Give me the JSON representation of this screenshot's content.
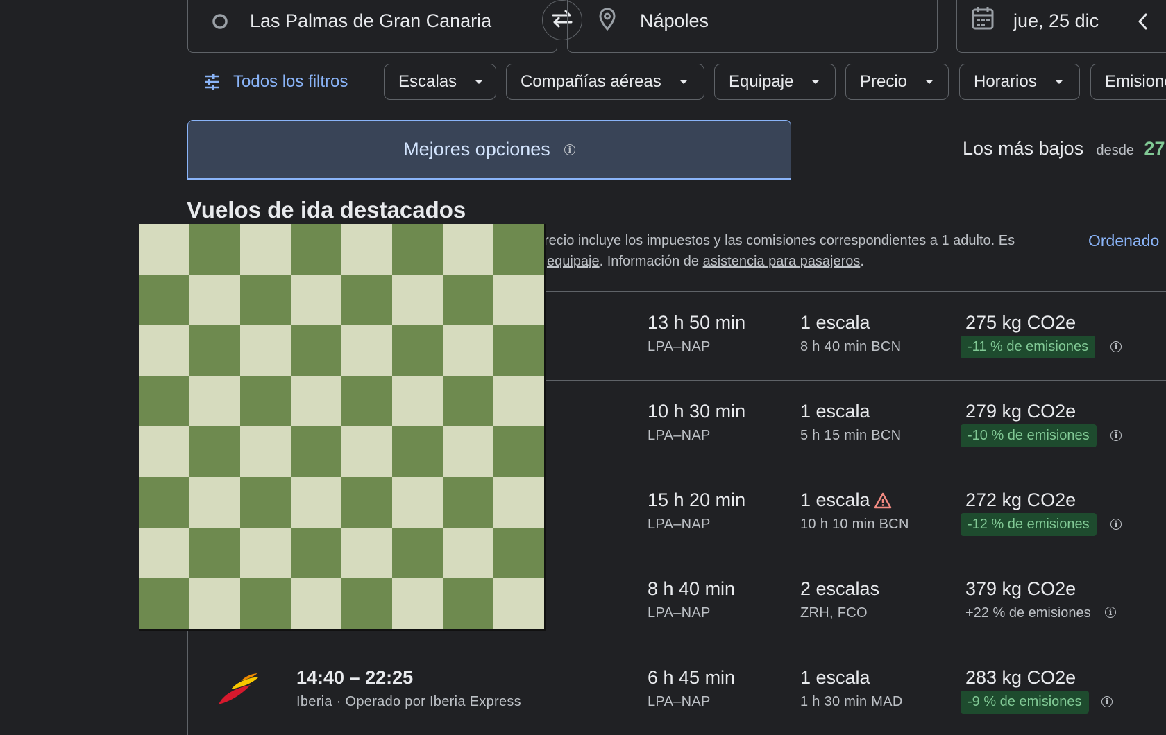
{
  "search": {
    "origin": "Las Palmas de Gran Canaria",
    "destination": "Nápoles",
    "date": "jue, 25 dic"
  },
  "filters": {
    "all_label": "Todos los filtros",
    "chips": [
      "Escalas",
      "Compañías aéreas",
      "Equipaje",
      "Precio",
      "Horarios",
      "Emisiones"
    ]
  },
  "tabs": {
    "best": "Mejores opciones",
    "lowest": "Los más bajos",
    "lowest_from": "desde",
    "lowest_price_visible": "27"
  },
  "section": {
    "title": "Vuelos de ida destacados",
    "notice_line1": "recio incluye los impuestos y las comisiones correspondientes a 1 adulto. Es",
    "notice_line2_link1": "equipaje",
    "notice_line2_mid": ". Información de ",
    "notice_line2_link2": "asistencia para pasajeros",
    "notice_line2_end": ".",
    "sort_label": "Ordenado"
  },
  "flights": [
    {
      "duration": "13 h 50 min",
      "route": "LPA–NAP",
      "stops": "1 escala",
      "stop_detail": "8 h 40 min BCN",
      "co2": "275 kg CO2e",
      "emissions": "-11 % de emisiones",
      "warning": false
    },
    {
      "duration": "10 h 30 min",
      "route": "LPA–NAP",
      "stops": "1 escala",
      "stop_detail": "5 h 15 min BCN",
      "co2": "279 kg CO2e",
      "emissions": "-10 % de emisiones",
      "warning": false
    },
    {
      "duration": "15 h 20 min",
      "route": "LPA–NAP",
      "stops": "1 escala",
      "stop_detail": "10 h 10 min BCN",
      "co2": "272 kg CO2e",
      "emissions": "-12 % de emisiones",
      "warning": true
    },
    {
      "duration": "8 h 40 min",
      "route": "LPA–NAP",
      "stops": "2 escalas",
      "stop_detail": "ZRH, FCO",
      "co2": "379 kg CO2e",
      "emissions": "+22 % de emisiones",
      "warning": false
    },
    {
      "times": "14:40 – 22:25",
      "airline": "Iberia · Operado por Iberia Express",
      "duration": "6 h 45 min",
      "route": "LPA–NAP",
      "stops": "1 escala",
      "stop_detail": "1 h 30 min MAD",
      "co2": "283 kg CO2e",
      "emissions": "-9 % de emisiones",
      "warning": false
    }
  ],
  "colors": {
    "background": "#202124",
    "accent": "#8ab4f8",
    "green_text": "#81c995",
    "badge_bg": "#1e4b2e",
    "checker_light": "#d6dbbe",
    "checker_dark": "#6e8a4f",
    "warning": "#f28b82"
  },
  "icons": {
    "origin": "circle-icon",
    "swap": "swap-arrows-icon",
    "destination": "location-pin-icon",
    "date": "calendar-icon",
    "prev": "chevron-left-icon",
    "filters": "tune-icon",
    "info": "info-icon",
    "warning": "warning-triangle-icon",
    "airline": "iberia-logo"
  }
}
